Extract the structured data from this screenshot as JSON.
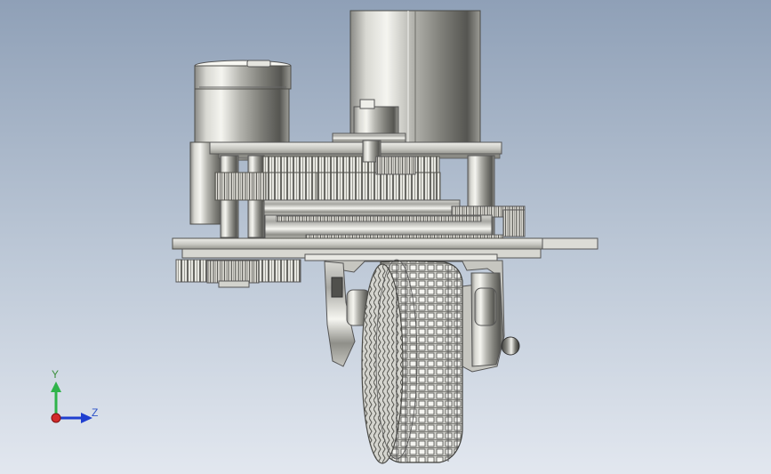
{
  "viewport": {
    "background_top": "#8fa0b7",
    "background_bottom": "#dfe5ee",
    "model": "gear-drive-wheel-assembly"
  },
  "triad": {
    "y_label": "Y",
    "z_label": "Z",
    "colors": {
      "x": "#d22b2b",
      "y": "#2fb34a",
      "z": "#1f3fd0"
    }
  }
}
